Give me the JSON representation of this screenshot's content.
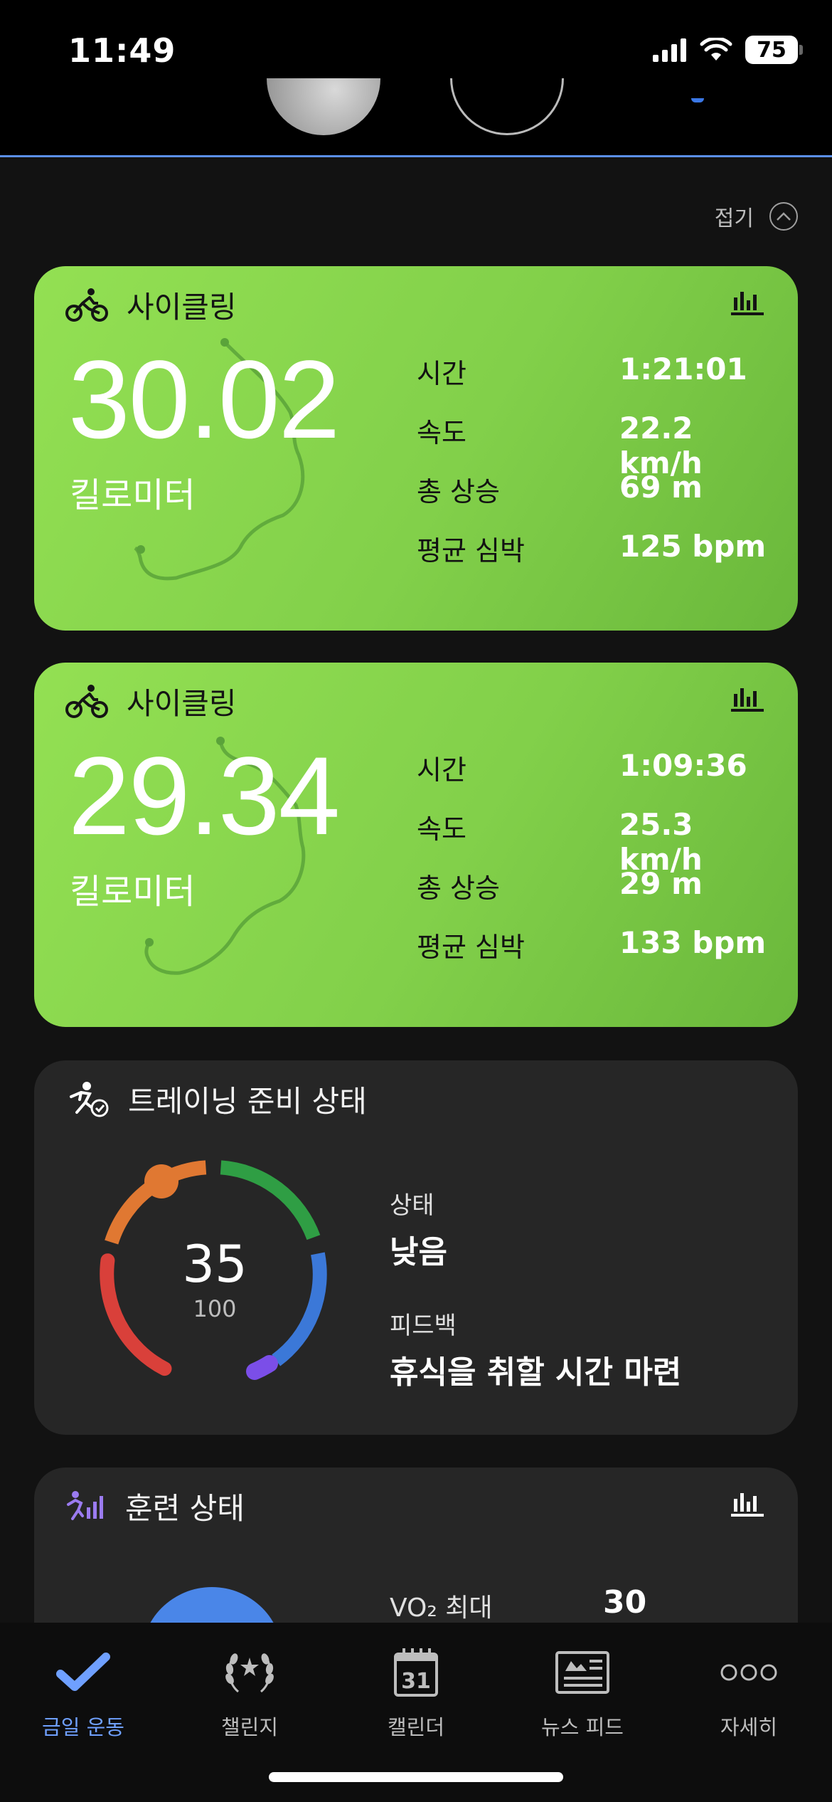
{
  "status_bar": {
    "time": "11:49",
    "battery": "75"
  },
  "header": {
    "collapse_label": "접기"
  },
  "activities": [
    {
      "title": "사이클링",
      "distance": "30.02",
      "unit": "킬로미터",
      "metrics": [
        {
          "label": "시간",
          "value": "1:21:01"
        },
        {
          "label": "속도",
          "value": "22.2 km/h"
        },
        {
          "label": "총 상승",
          "value": "69 m"
        },
        {
          "label": "평균 심박",
          "value": "125 bpm"
        }
      ]
    },
    {
      "title": "사이클링",
      "distance": "29.34",
      "unit": "킬로미터",
      "metrics": [
        {
          "label": "시간",
          "value": "1:09:36"
        },
        {
          "label": "속도",
          "value": "25.3 km/h"
        },
        {
          "label": "총 상승",
          "value": "29 m"
        },
        {
          "label": "평균 심박",
          "value": "133 bpm"
        }
      ]
    }
  ],
  "readiness": {
    "title": "트레이닝 준비 상태",
    "score": "35",
    "max": "100",
    "status_label": "상태",
    "status_value": "낮음",
    "feedback_label": "피드백",
    "feedback_value": "휴식을 취할 시간 마련"
  },
  "training_status": {
    "title": "훈련 상태",
    "vo2_label": "VO₂ 최대",
    "vo2_value": "30"
  },
  "tabs": [
    {
      "label": "금일 운동",
      "icon": "check-icon",
      "active": true
    },
    {
      "label": "챌린지",
      "icon": "laurel-icon",
      "active": false
    },
    {
      "label": "캘린더",
      "icon": "calendar-icon",
      "active": false,
      "day": "31"
    },
    {
      "label": "뉴스 피드",
      "icon": "newspaper-icon",
      "active": false
    },
    {
      "label": "자세히",
      "icon": "more-icon",
      "active": false
    }
  ],
  "colors": {
    "card_green": "#86d34c",
    "card_dark": "#262626",
    "accent_blue": "#6fa0ff",
    "gauge_red": "#d9403a",
    "gauge_orange": "#e07832",
    "gauge_green": "#2f9e44",
    "gauge_blue": "#3b78d8",
    "gauge_purple": "#7b4ee8"
  }
}
